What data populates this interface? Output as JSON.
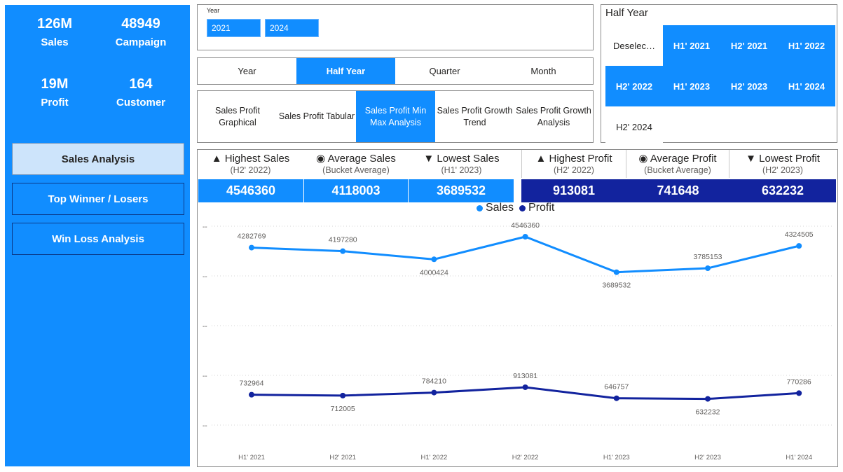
{
  "kpis": [
    {
      "value": "126M",
      "label": "Sales"
    },
    {
      "value": "48949",
      "label": "Campaign"
    },
    {
      "value": "19M",
      "label": "Profit"
    },
    {
      "value": "164",
      "label": "Customer"
    }
  ],
  "nav": [
    {
      "label": "Sales Analysis",
      "active": true
    },
    {
      "label": "Top Winner / Losers",
      "active": false
    },
    {
      "label": "Win Loss Analysis",
      "active": false
    }
  ],
  "year_slicer": {
    "caption": "Year",
    "from": "2021",
    "to": "2024"
  },
  "period_tabs": [
    {
      "label": "Year",
      "active": false
    },
    {
      "label": "Half Year",
      "active": true
    },
    {
      "label": "Quarter",
      "active": false
    },
    {
      "label": "Month",
      "active": false
    }
  ],
  "analysis_tabs": [
    {
      "line1": "Sales Profit",
      "line2": "Graphical",
      "active": false
    },
    {
      "line1": "Sales Profit Tabular",
      "line2": "",
      "active": false
    },
    {
      "line1": "Sales Profit Min",
      "line2": "Max Analysis",
      "active": true
    },
    {
      "line1": "Sales Profit Growth",
      "line2": "Trend",
      "active": false
    },
    {
      "line1": "Sales Profit Growth",
      "line2": "Analysis",
      "active": false
    }
  ],
  "half_year_slicer": {
    "title": "Half Year",
    "items": [
      {
        "label": "Deselec…",
        "selected": false
      },
      {
        "label": "H1' 2021",
        "selected": true
      },
      {
        "label": "H2' 2021",
        "selected": true
      },
      {
        "label": "H1' 2022",
        "selected": true
      },
      {
        "label": "H2' 2022",
        "selected": true
      },
      {
        "label": "H1' 2023",
        "selected": true
      },
      {
        "label": "H2' 2023",
        "selected": true
      },
      {
        "label": "H1' 2024",
        "selected": true
      },
      {
        "label": "H2' 2024",
        "selected": false
      }
    ]
  },
  "stats": {
    "sales": [
      {
        "title": "▲ Highest Sales",
        "sub": "(H2' 2022)",
        "value": "4546360"
      },
      {
        "title": "◉ Average Sales",
        "sub": "(Bucket Average)",
        "value": "4118003"
      },
      {
        "title": "▼ Lowest Sales",
        "sub": "(H1' 2023)",
        "value": "3689532"
      }
    ],
    "profit": [
      {
        "title": "▲ Highest Profit",
        "sub": "(H2' 2022)",
        "value": "913081"
      },
      {
        "title": "◉ Average Profit",
        "sub": "(Bucket Average)",
        "value": "741648"
      },
      {
        "title": "▼ Lowest Profit",
        "sub": "(H2' 2023)",
        "value": "632232"
      }
    ]
  },
  "chart_data": {
    "type": "line",
    "x": [
      "H1' 2021",
      "H2' 2021",
      "H1' 2022",
      "H2' 2022",
      "H1' 2023",
      "H2' 2023",
      "H1' 2024"
    ],
    "series": [
      {
        "name": "Sales",
        "color": "#118DFF",
        "values": [
          4282769,
          4197280,
          4000424,
          4546360,
          3689532,
          3785153,
          4324505
        ]
      },
      {
        "name": "Profit",
        "color": "#12239E",
        "values": [
          732964,
          712005,
          784210,
          913081,
          646757,
          632232,
          770286
        ]
      }
    ],
    "y_tick_labels": [
      "--",
      "--",
      "--",
      "--",
      "--"
    ],
    "legend_position": "top-center",
    "grid": true
  }
}
